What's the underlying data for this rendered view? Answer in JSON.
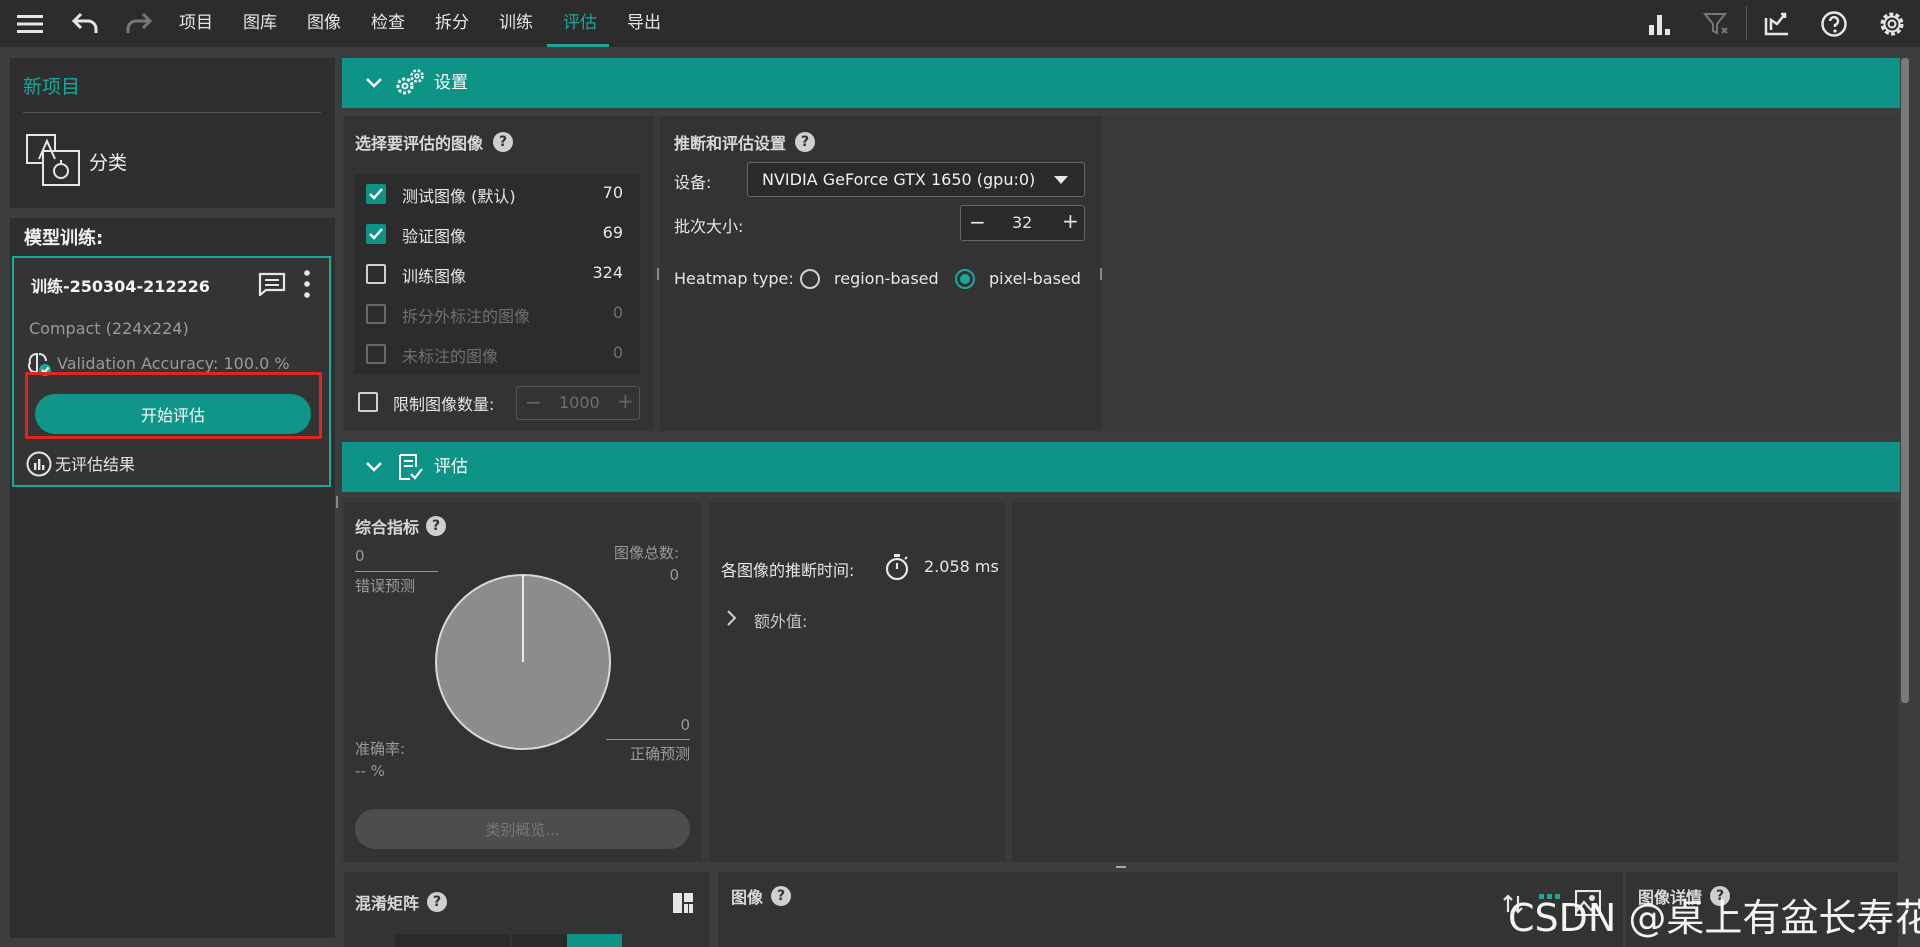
{
  "menu": {
    "items": [
      "项目",
      "图库",
      "图像",
      "检查",
      "拆分",
      "训练",
      "评估",
      "导出"
    ],
    "active": "评估"
  },
  "sidebar": {
    "project_title": "新项目",
    "project_type": "分类",
    "model_section_title": "模型训练:",
    "training": {
      "name": "训练-250304-212226",
      "model": "Compact (224x224)",
      "validation_accuracy": "Validation Accuracy: 100.0 %",
      "start_eval_label": "开始评估",
      "no_results": "无评估结果"
    }
  },
  "settings": {
    "header": "设置",
    "select_images": {
      "title": "选择要评估的图像",
      "rows": [
        {
          "label": "测试图像 (默认)",
          "count": "70",
          "checked": true,
          "enabled": true
        },
        {
          "label": "验证图像",
          "count": "69",
          "checked": true,
          "enabled": true
        },
        {
          "label": "训练图像",
          "count": "324",
          "checked": false,
          "enabled": true
        },
        {
          "label": "拆分外标注的图像",
          "count": "0",
          "checked": false,
          "enabled": false
        },
        {
          "label": "未标注的图像",
          "count": "0",
          "checked": false,
          "enabled": false
        }
      ],
      "limit_label": "限制图像数量:",
      "limit_value": "1000"
    },
    "inference": {
      "title": "推断和评估设置",
      "device_label": "设备:",
      "device_value": "NVIDIA GeForce GTX 1650 (gpu:0)",
      "batch_label": "批次大小:",
      "batch_value": "32",
      "heatmap_label": "Heatmap type:",
      "heatmap_options": [
        "region-based",
        "pixel-based"
      ],
      "heatmap_selected": "pixel-based"
    }
  },
  "evaluation": {
    "header": "评估",
    "summary": {
      "title": "综合指标",
      "wrong_value": "0",
      "wrong_label": "错误预测",
      "total_label": "图像总数:",
      "total_value": "0",
      "correct_value": "0",
      "correct_label": "正确预测",
      "accuracy_label": "准确率:",
      "accuracy_value": "-- %",
      "class_overview_label": "类别概览..."
    },
    "inference_time": {
      "label": "各图像的推断时间:",
      "value": "2.058 ms",
      "extra_label": "额外值:"
    }
  },
  "bottom": {
    "confusion_title": "混淆矩阵",
    "images_title": "图像",
    "image_details_title": "图像详情"
  },
  "watermark": "CSDN @桌上有盆长寿花",
  "colors": {
    "accent": "#0e9486",
    "accent_text": "#1aa89a",
    "highlight": "#e0251f"
  }
}
